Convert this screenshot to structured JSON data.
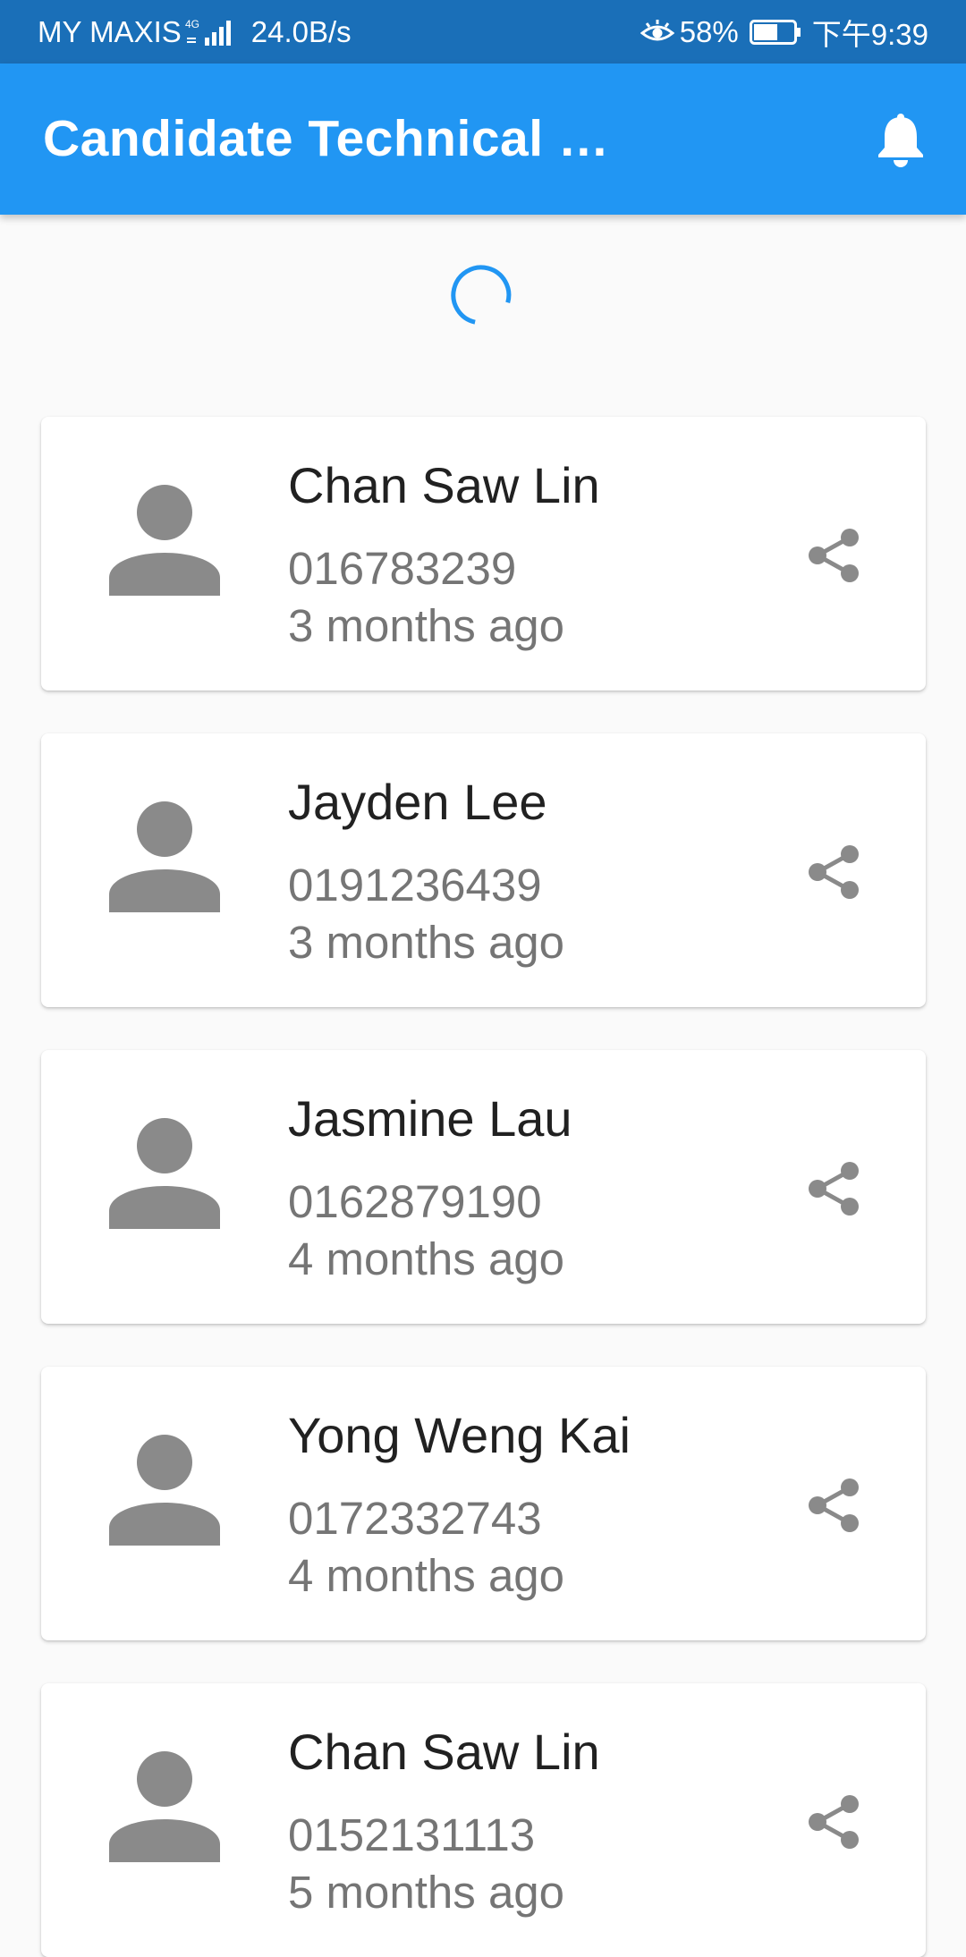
{
  "status_bar": {
    "carrier": "MY MAXIS",
    "network": "4G",
    "speed": "24.0B/s",
    "battery": "58%",
    "time": "下午9:39"
  },
  "app_bar": {
    "title": "Candidate Technical …",
    "notification_icon": "bell-icon"
  },
  "colors": {
    "status_bar": "#1a6fb8",
    "app_bar": "#2196f3",
    "background": "#fafafa",
    "icon_grey": "#8a8a8a"
  },
  "candidates": [
    {
      "name": "Chan Saw Lin",
      "phone": "016783239",
      "time": "3 months ago"
    },
    {
      "name": "Jayden Lee",
      "phone": "0191236439",
      "time": "3 months ago"
    },
    {
      "name": "Jasmine Lau",
      "phone": "0162879190",
      "time": "4 months ago"
    },
    {
      "name": "Yong Weng Kai",
      "phone": "0172332743",
      "time": "4 months ago"
    },
    {
      "name": "Chan Saw Lin",
      "phone": "0152131113",
      "time": "5 months ago"
    }
  ]
}
